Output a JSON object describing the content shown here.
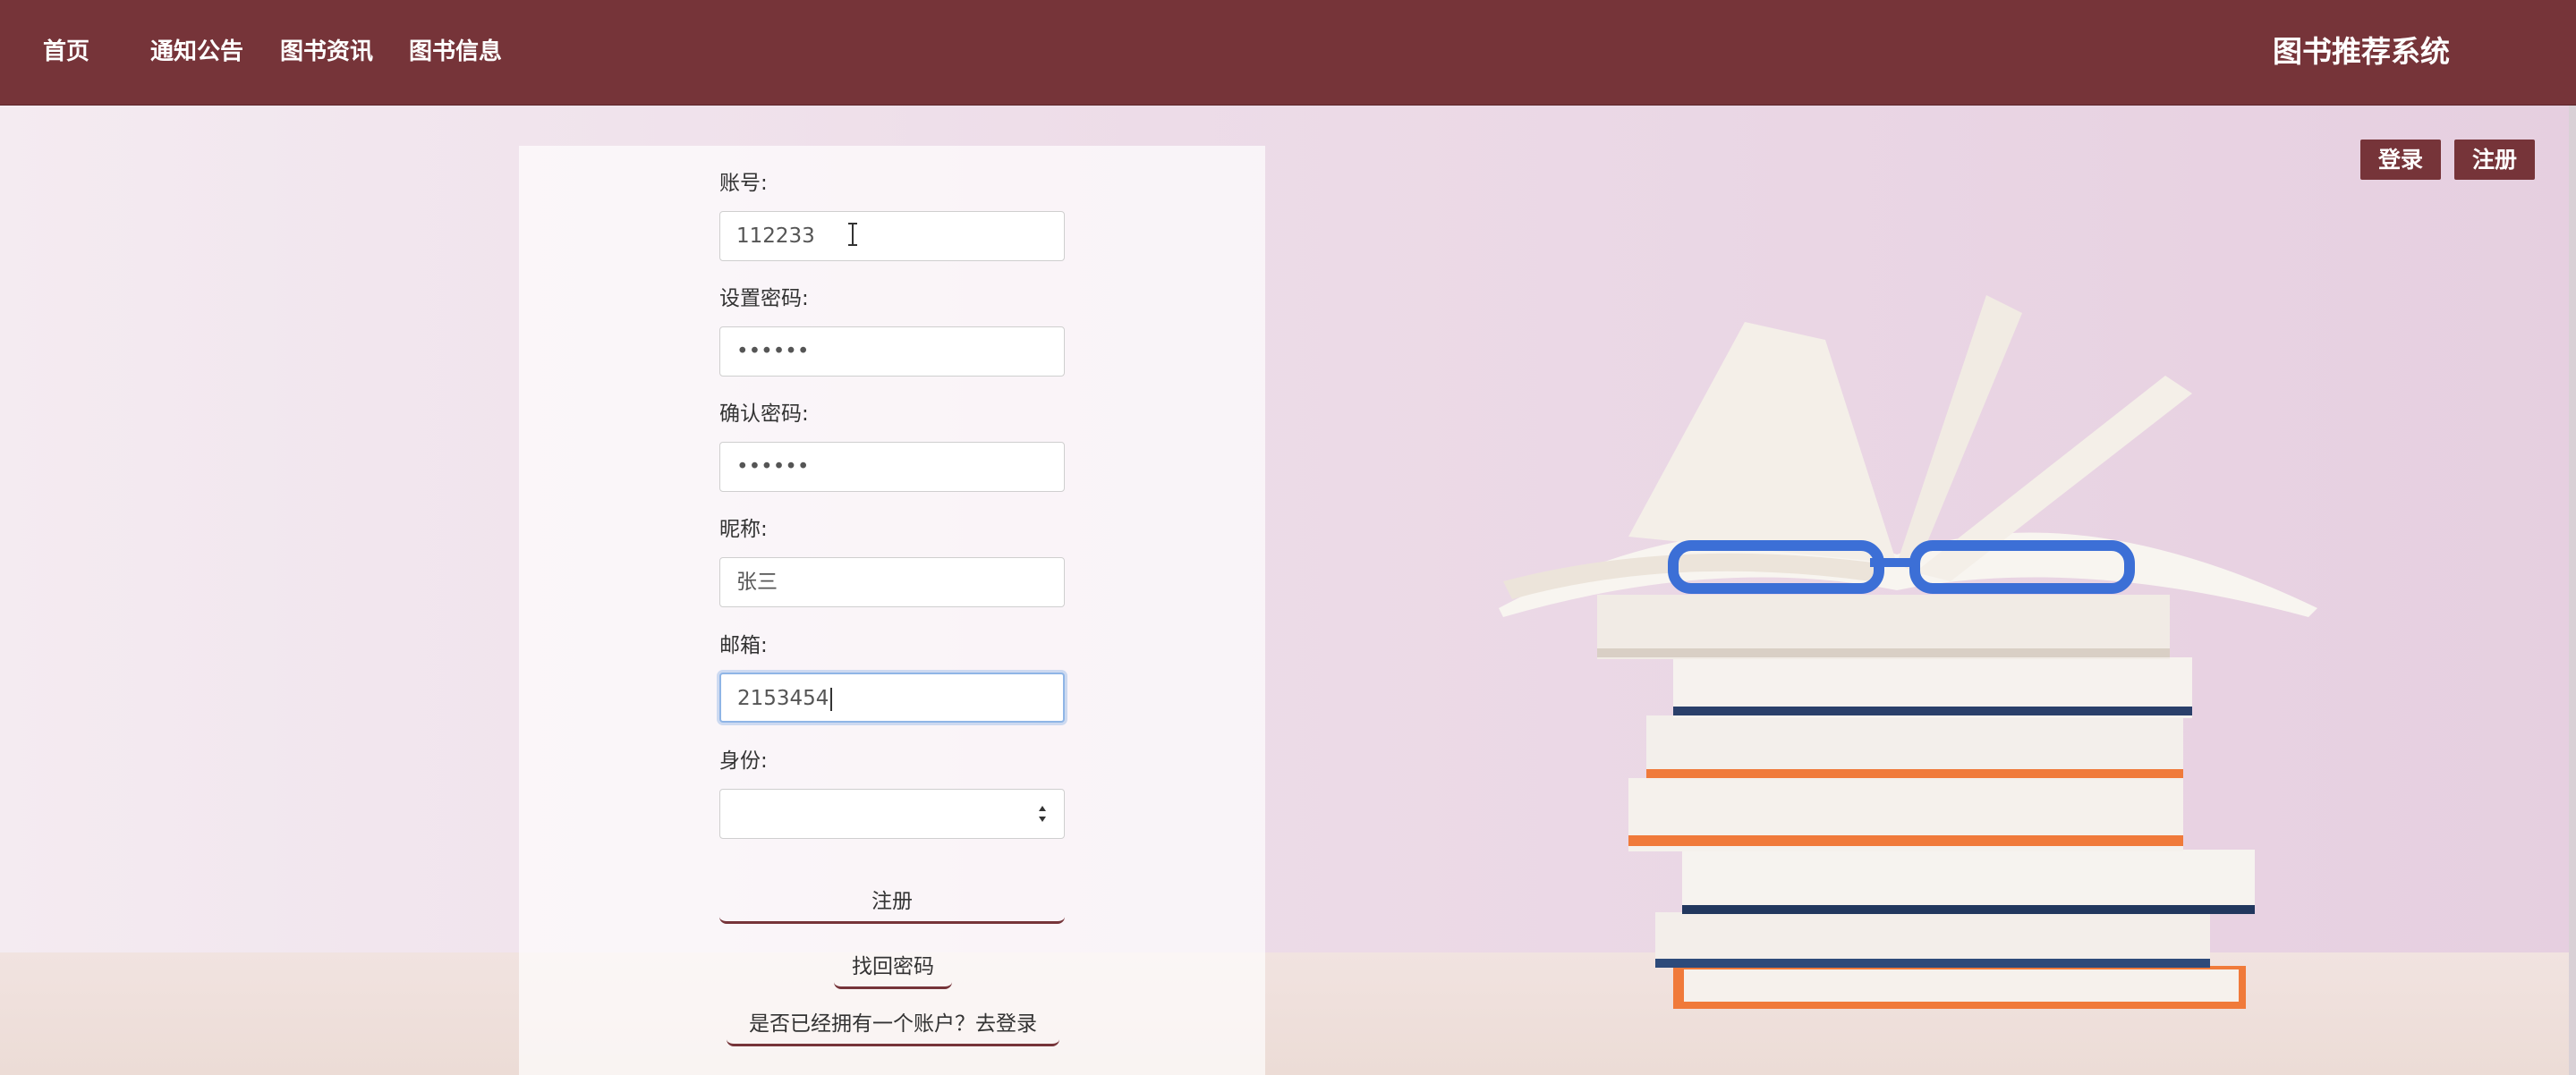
{
  "nav": {
    "items": [
      {
        "label": "首页"
      },
      {
        "label": "通知公告"
      },
      {
        "label": "图书资讯"
      },
      {
        "label": "图书信息"
      }
    ],
    "brand": "图书推荐系统"
  },
  "auth": {
    "login_label": "登录",
    "register_label": "注册"
  },
  "form": {
    "account": {
      "label": "账号:",
      "value": "112233"
    },
    "password": {
      "label": "设置密码:",
      "value": "••••••"
    },
    "confirm": {
      "label": "确认密码:",
      "value": "••••••"
    },
    "nickname": {
      "label": "昵称:",
      "value": "张三"
    },
    "email": {
      "label": "邮箱:",
      "value": "2153454"
    },
    "role": {
      "label": "身份:",
      "value": ""
    },
    "submit_label": "注册",
    "recover_label": "找回密码",
    "login_link_label": "是否已经拥有一个账户？去登录"
  },
  "colors": {
    "primary": "#763439",
    "focus": "#8fb5e6"
  }
}
